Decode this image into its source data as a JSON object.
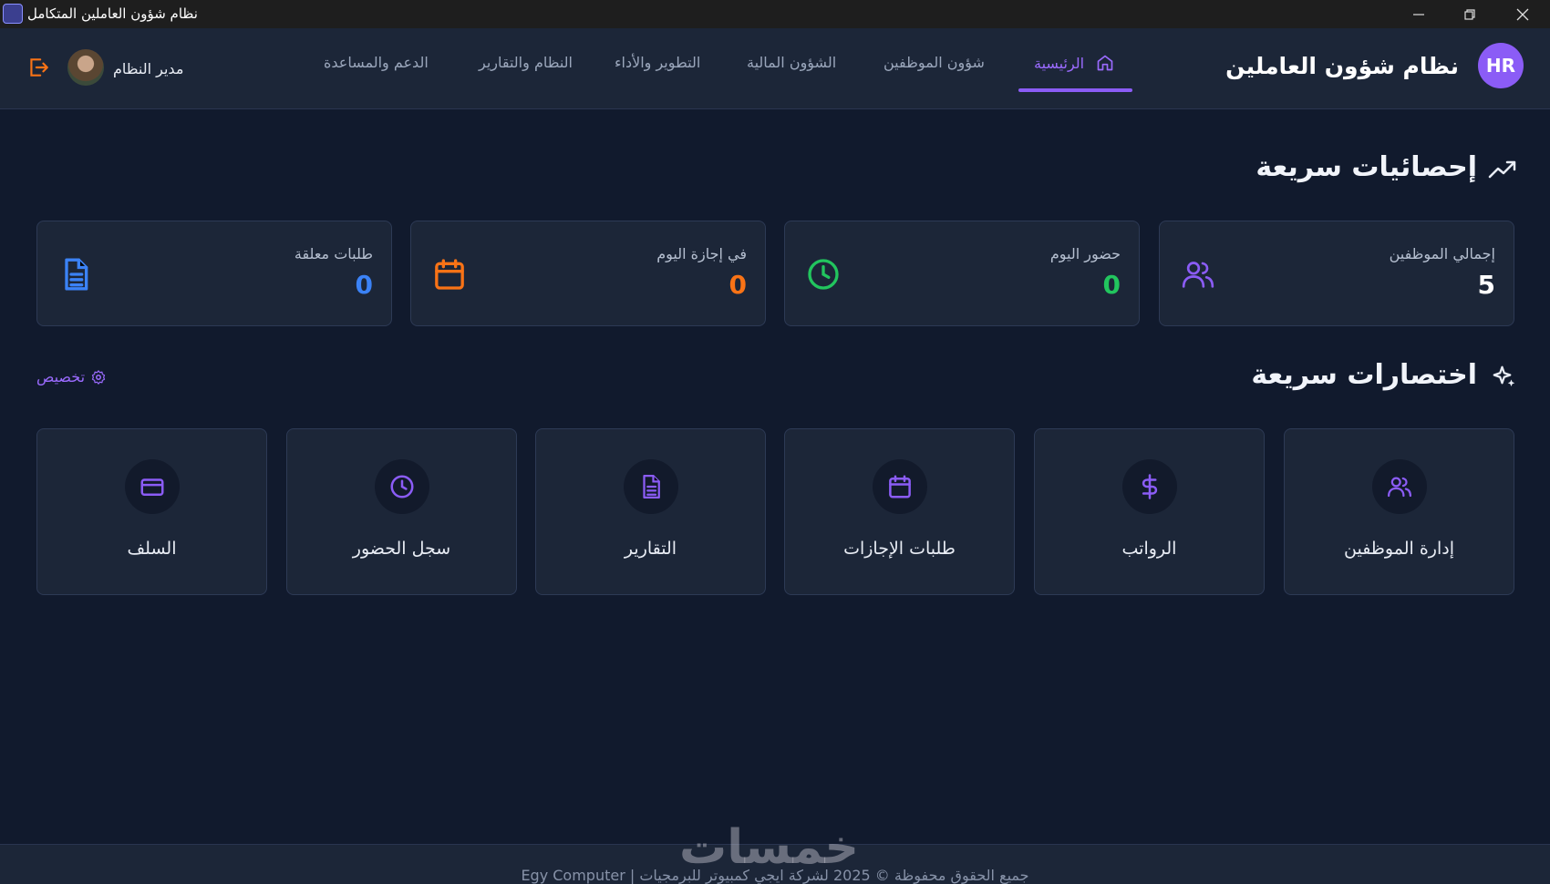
{
  "window": {
    "title": "نظام شؤون العاملين المتكامل",
    "controls": [
      "minimize-icon",
      "restore-icon",
      "close-icon"
    ]
  },
  "header": {
    "logo_text": "HR",
    "brand": "نظام شؤون العاملين",
    "nav": [
      {
        "label": "الرئيسية",
        "active": true,
        "icon": "home-icon"
      },
      {
        "label": "شؤون الموظفين",
        "active": false
      },
      {
        "label": "الشؤون المالية",
        "active": false
      },
      {
        "label": "التطوير والأداء",
        "active": false
      },
      {
        "label": "النظام والتقارير",
        "active": false
      },
      {
        "label": "الدعم والمساعدة",
        "active": false
      }
    ],
    "user_name": "مدير النظام",
    "logout_icon": "logout-icon"
  },
  "stats": {
    "title": "إحصائيات سريعة",
    "icon": "trending-up-icon",
    "cards": [
      {
        "label": "إجمالي الموظفين",
        "value": "5",
        "color": "#ffffff",
        "icon": "users-icon",
        "icon_color": "#8b5cf6"
      },
      {
        "label": "حضور اليوم",
        "value": "0",
        "color": "#22c55e",
        "icon": "clock-icon",
        "icon_color": "#22c55e"
      },
      {
        "label": "في إجازة اليوم",
        "value": "0",
        "color": "#f97316",
        "icon": "calendar-icon",
        "icon_color": "#f97316"
      },
      {
        "label": "طلبات معلقة",
        "value": "0",
        "color": "#3b82f6",
        "icon": "document-icon",
        "icon_color": "#3b82f6"
      }
    ]
  },
  "shortcuts": {
    "title": "اختصارات سريعة",
    "icon": "sparkles-icon",
    "customize_label": "تخصيص",
    "customize_icon": "gear-icon",
    "items": [
      {
        "label": "إدارة الموظفين",
        "icon": "users-icon"
      },
      {
        "label": "الرواتب",
        "icon": "dollar-icon"
      },
      {
        "label": "طلبات الإجازات",
        "icon": "calendar-icon"
      },
      {
        "label": "التقارير",
        "icon": "document-icon"
      },
      {
        "label": "سجل الحضور",
        "icon": "clock-icon"
      },
      {
        "label": "السلف",
        "icon": "credit-card-icon"
      }
    ]
  },
  "footer": {
    "text": "جميع الحقوق محفوظة © 2025 لشركة ايجي كمبيوتر للبرمجيات | Egy Computer"
  },
  "watermark": "خمسات",
  "colors": {
    "accent": "#8b5cf6",
    "background": "#111a2d",
    "card": "#1c2638"
  }
}
